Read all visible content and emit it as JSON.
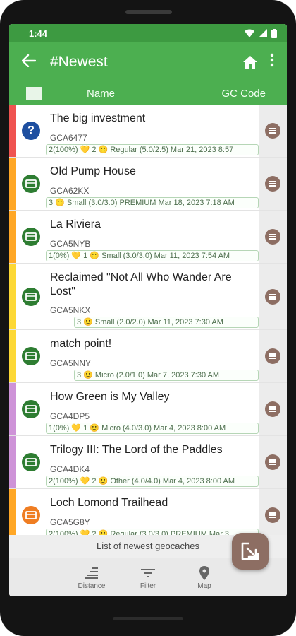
{
  "status": {
    "time": "1:44"
  },
  "appbar": {
    "title": "#Newest",
    "back_icon": "arrow-back-icon",
    "home_icon": "home-icon",
    "more_icon": "more-vert-icon"
  },
  "columns": {
    "name": "Name",
    "code": "GC Code"
  },
  "rows": [
    {
      "name": "The big investment",
      "code": "GCA6477",
      "info": "2(100%) 💛 2 🙂  Regular  (5.0/2.5)  Mar 21, 2023  8:57",
      "type": "mystery",
      "stripe": "#ef5350"
    },
    {
      "name": "Old Pump House",
      "code": "GCA62KX",
      "info": "3 🙂  Small  (3.0/3.0)  PREMIUM  Mar 18, 2023  7:18 AM",
      "type": "traditional",
      "stripe": "#ffa726"
    },
    {
      "name": "La Riviera",
      "code": "GCA5NYB",
      "info": "1(0%) 💛 1 🙂  Small  (3.0/3.0)  Mar 11, 2023  7:54 AM",
      "type": "traditional",
      "stripe": "#ffa726"
    },
    {
      "name": "Reclaimed \"Not All Who Wander Are Lost\"",
      "code": "GCA5NKX",
      "info": "3 🙂  Small  (2.0/2.0)  Mar 11, 2023  7:30 AM",
      "type": "traditional",
      "stripe": "#fdd835"
    },
    {
      "name": "match point!",
      "code": "GCA5NNY",
      "info": "3 🙂  Micro  (2.0/1.0)  Mar 7, 2023  7:30 AM",
      "type": "traditional",
      "stripe": "#fdd835"
    },
    {
      "name": "How Green is My Valley",
      "code": "GCA4DP5",
      "info": "1(0%) 💛 1 🙂  Micro  (4.0/3.0)  Mar 4, 2023  8:00 AM",
      "type": "traditional",
      "stripe": "#ce93d8"
    },
    {
      "name": "Trilogy III: The Lord of the Paddles",
      "code": "GCA4DK4",
      "info": "2(100%) 💛 2 🙂  Other  (4.0/4.0)  Mar 4, 2023  8:00 AM",
      "type": "traditional",
      "stripe": "#ce93d8"
    },
    {
      "name": "Loch Lomond Trailhead",
      "code": "GCA5G8Y",
      "info": "2(100%) 💛 2 🙂  Regular  (3.0/3.0)  PREMIUM  Mar 3",
      "type": "traditional-orange",
      "stripe": "#ffa726"
    }
  ],
  "footer": {
    "list_info": "List of newest geocaches"
  },
  "bottom_nav": [
    {
      "label": "Distance",
      "icon": "sort-icon"
    },
    {
      "label": "Filter",
      "icon": "filter-icon"
    },
    {
      "label": "Map",
      "icon": "map-pin-icon"
    }
  ],
  "fab_icon": "open-external-icon",
  "colors": {
    "primary": "#4caf50",
    "status": "#3d9a41",
    "accent": "#8d6e63"
  }
}
